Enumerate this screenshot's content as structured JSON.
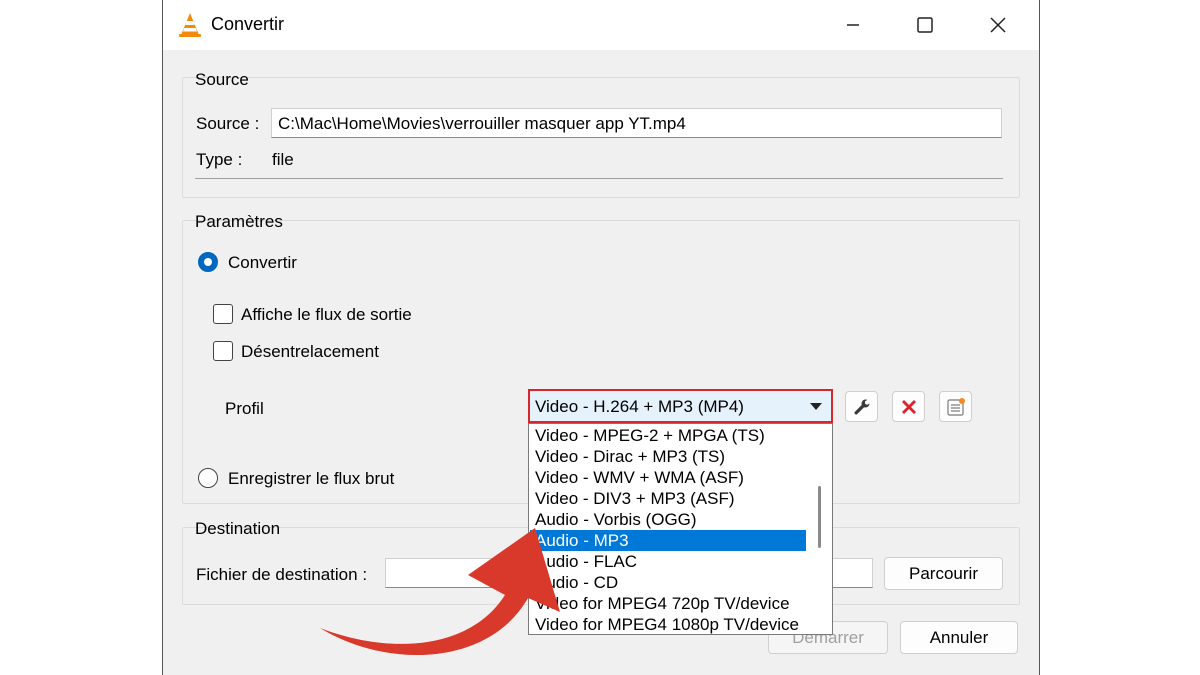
{
  "window": {
    "title": "Convertir",
    "icon": "vlc-cone-icon"
  },
  "source_group": {
    "title": "Source",
    "source_label": "Source :",
    "source_value": "C:\\Mac\\Home\\Movies\\verrouiller masquer app YT.mp4",
    "type_label": "Type :",
    "type_value": "file"
  },
  "settings_group": {
    "title": "Paramètres",
    "convert_radio": {
      "label": "Convertir",
      "checked": true
    },
    "show_output_checkbox": {
      "label": "Affiche le flux de sortie",
      "checked": false
    },
    "deinterlace_checkbox": {
      "label": "Désentrelacement",
      "checked": false
    },
    "profile_label": "Profil",
    "profile_selected": "Video - H.264 + MP3 (MP4)",
    "profile_options": [
      "Video - MPEG-2 + MPGA (TS)",
      "Video - Dirac + MP3 (TS)",
      "Video - WMV + WMA (ASF)",
      "Video - DIV3 + MP3 (ASF)",
      "Audio - Vorbis (OGG)",
      "Audio - MP3",
      "Audio - FLAC",
      "Audio - CD",
      "Video for MPEG4 720p TV/device",
      "Video for MPEG4 1080p TV/device"
    ],
    "highlighted_option": "Audio - MP3",
    "raw_radio": {
      "label": "Enregistrer le flux brut",
      "checked": false
    }
  },
  "destination_group": {
    "title": "Destination",
    "file_label": "Fichier de destination :",
    "file_value": "",
    "browse_label": "Parcourir"
  },
  "footer": {
    "start_label": "Démarrer",
    "cancel_label": "Annuler"
  },
  "colors": {
    "highlight": "#0078d7",
    "callout_border": "#d9262b",
    "arrow": "#d8392b",
    "accent": "#0067c0"
  }
}
